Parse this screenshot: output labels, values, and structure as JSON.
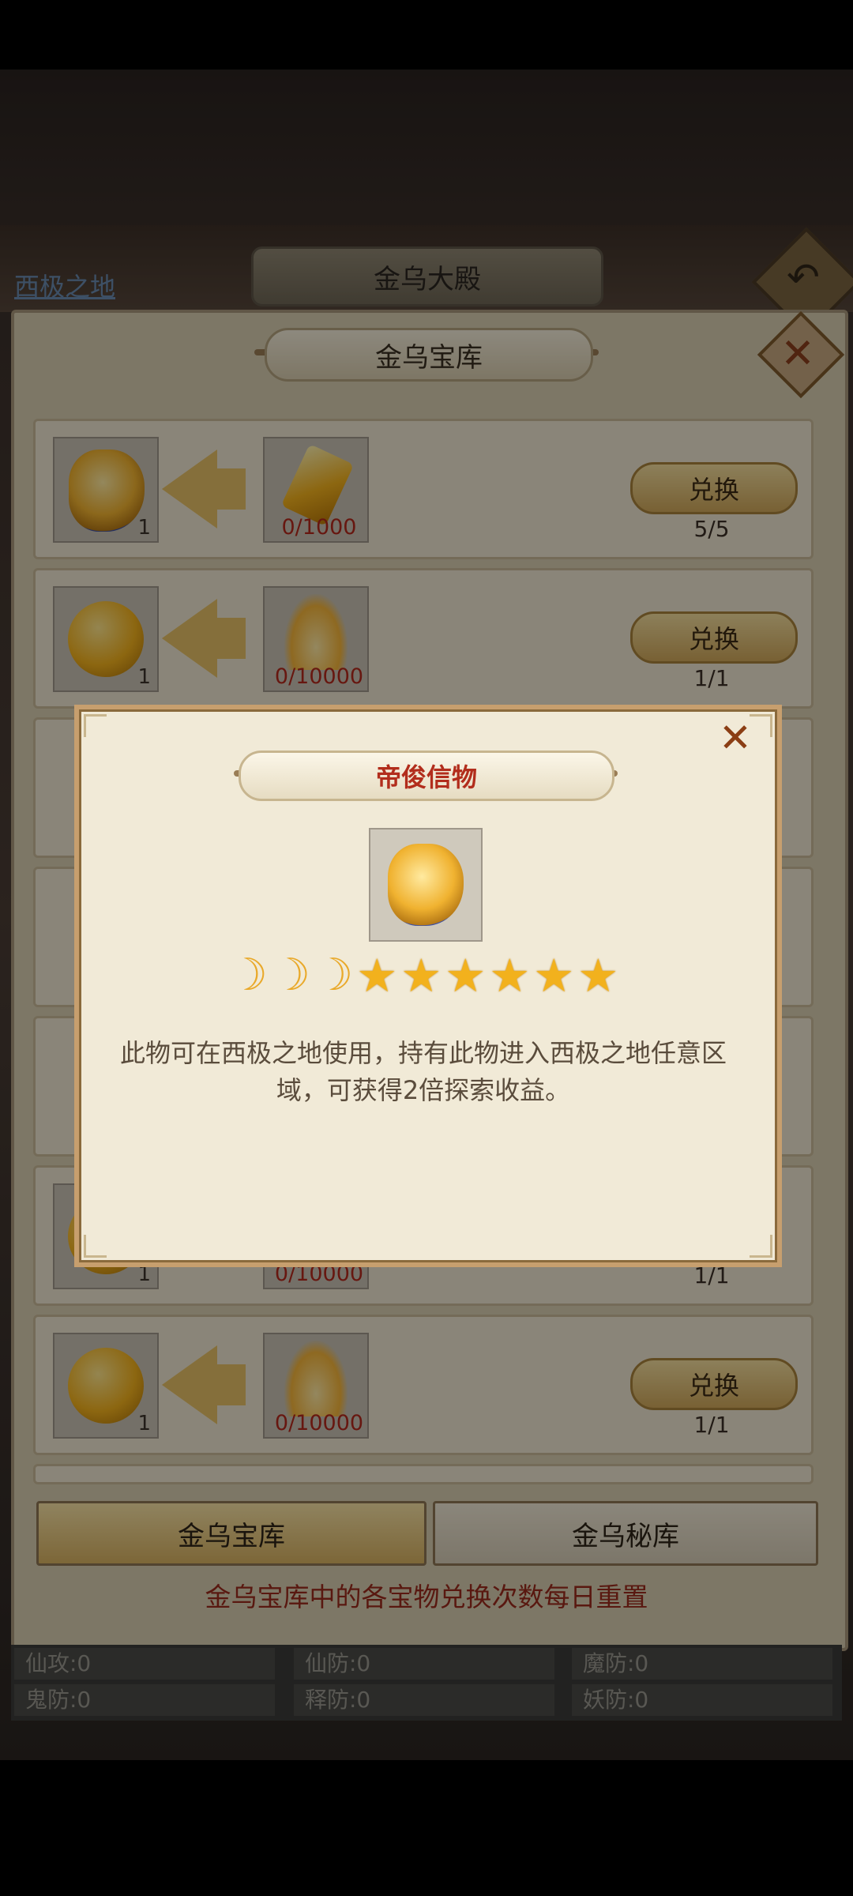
{
  "header": {
    "region_link": "西极之地",
    "hall_title": "金乌大殿"
  },
  "panel": {
    "title": "金乌宝库"
  },
  "rows": [
    {
      "reward_count": "1",
      "cost": "0/1000",
      "button": "兑换",
      "limit": "5/5"
    },
    {
      "reward_count": "1",
      "cost": "0/10000",
      "button": "兑换",
      "limit": "1/1"
    },
    {
      "reward_count": "1",
      "cost": "0/10000",
      "button": "兑换",
      "limit": "1/1"
    },
    {
      "reward_count": "1",
      "cost": "0/10000",
      "button": "兑换",
      "limit": "1/1"
    }
  ],
  "tabs": {
    "treasury": "金乌宝库",
    "secret": "金乌秘库"
  },
  "footer_note": "金乌宝库中的各宝物兑换次数每日重置",
  "stats": [
    "仙攻:0",
    "仙防:0",
    "魔防:0",
    "鬼防:0",
    "释防:0",
    "妖防:0"
  ],
  "modal": {
    "title": "帝俊信物",
    "rating": {
      "moons": 3,
      "stars": 6
    },
    "description": "此物可在西极之地使用，持有此物进入西极之地任意区域，可获得2倍探索收益。"
  },
  "icons": {
    "back": "back-arrow-icon",
    "close": "close-icon",
    "moon": "crescent-moon-icon",
    "star": "star-icon"
  },
  "colors": {
    "accent_red": "#b22d1c",
    "gold": "#f2b11d"
  }
}
